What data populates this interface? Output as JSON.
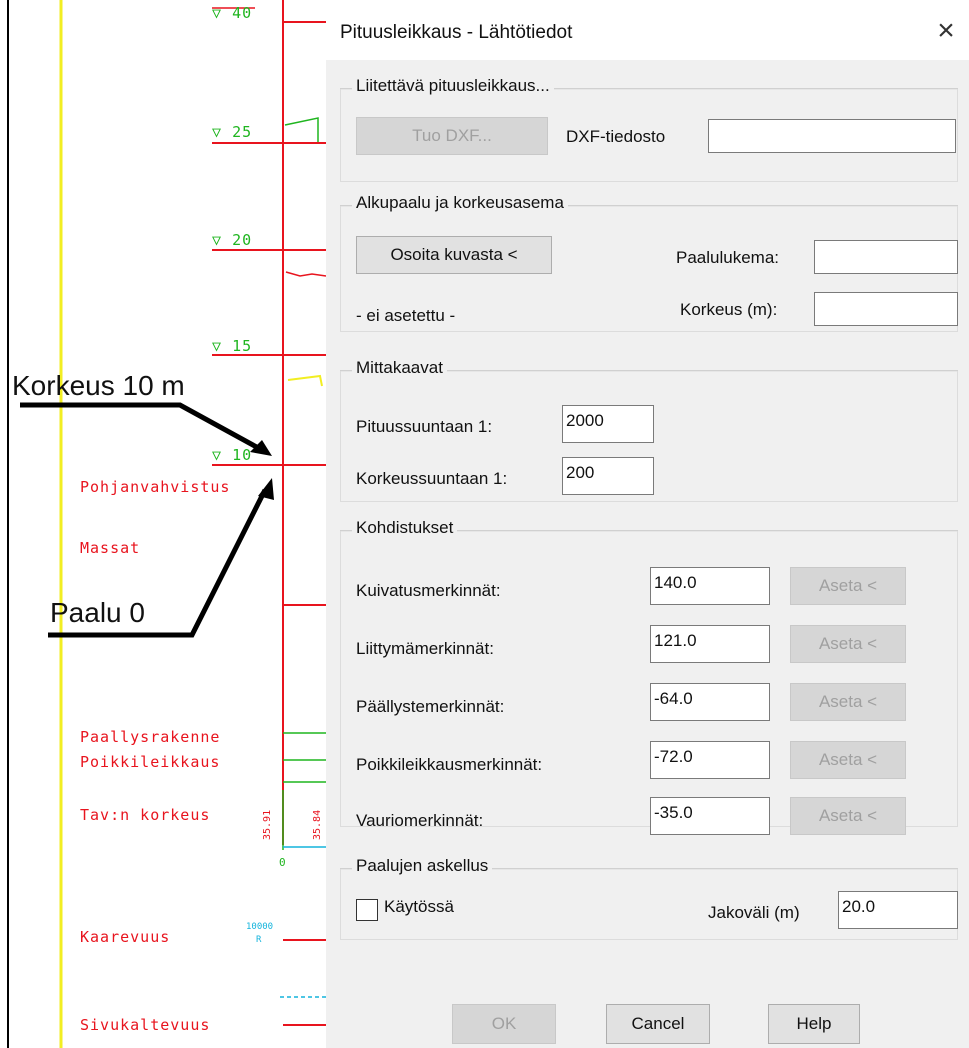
{
  "cad": {
    "level_labels": [
      "40",
      "25",
      "20",
      "15",
      "10"
    ],
    "row_labels": [
      "Pohjanvahvistus",
      "Massat",
      "Paallysrakenne",
      "Poikkileikkaus",
      "Tav:n korkeus",
      "Kaarevuus",
      "Sivukaltevuus"
    ],
    "annotations": [
      "Korkeus 10 m",
      "Paalu 0"
    ],
    "small_values": [
      "35.91",
      "35.84",
      "0",
      "10000",
      "R"
    ]
  },
  "dialog": {
    "title": "Pituusleikkaus - Lähtötiedot",
    "attach": {
      "group_title": "Liitettävä pituusleikkaus...",
      "import_button": "Tuo DXF...",
      "file_label": "DXF-tiedosto",
      "file_value": ""
    },
    "start": {
      "group_title": "Alkupaalu ja korkeusasema",
      "pick_button": "Osoita kuvasta <",
      "status": "- ei asetettu -",
      "station_label": "Paalulukema:",
      "station_value": "",
      "height_label": "Korkeus (m):",
      "height_value": ""
    },
    "scales": {
      "group_title": "Mittakaavat",
      "horizontal_label": "Pituussuuntaan  1:",
      "horizontal_value": "2000",
      "vertical_label": "Korkeussuuntaan 1:",
      "vertical_value": "200"
    },
    "targets": {
      "group_title": "Kohdistukset",
      "set_label": "Aseta <",
      "rows": [
        {
          "label": "Kuivatusmerkinnät:",
          "value": "140.0"
        },
        {
          "label": "Liittymämerkinnät:",
          "value": "121.0"
        },
        {
          "label": "Päällystemerkinnät:",
          "value": "-64.0"
        },
        {
          "label": "Poikkileikkausmerkinnät:",
          "value": "-72.0"
        },
        {
          "label": "Vauriomerkinnät:",
          "value": "-35.0"
        }
      ]
    },
    "stepping": {
      "group_title": "Paalujen askellus",
      "enabled_label": "Käytössä",
      "enabled": false,
      "interval_label": "Jakoväli (m)",
      "interval_value": "20.0"
    },
    "buttons": {
      "ok": "OK",
      "cancel": "Cancel",
      "help": "Help"
    }
  }
}
